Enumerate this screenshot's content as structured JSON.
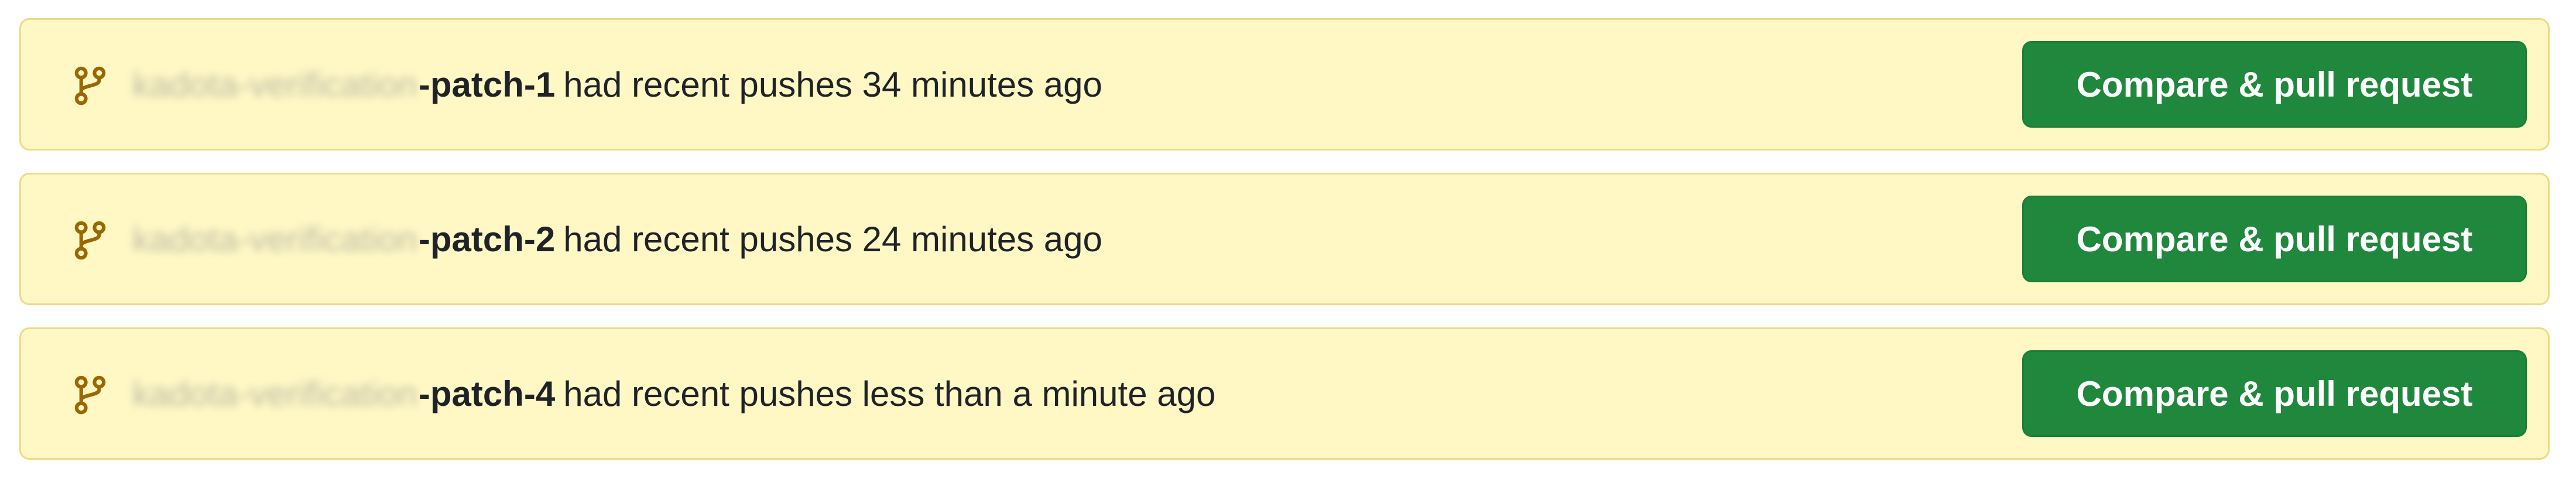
{
  "colors": {
    "banner_background": "#fff8c5",
    "banner_border": "#eedb82",
    "icon": "#9a6700",
    "button_background": "#1f883d",
    "button_text": "#ffffff",
    "text": "#1f2328"
  },
  "banners": [
    {
      "icon": "git-branch-icon",
      "branch_owner": "kadota-verification",
      "branch_suffix": "-patch-1",
      "message": "had recent pushes 34 minutes ago",
      "button_label": "Compare & pull request"
    },
    {
      "icon": "git-branch-icon",
      "branch_owner": "kadota-verification",
      "branch_suffix": "-patch-2",
      "message": "had recent pushes 24 minutes ago",
      "button_label": "Compare & pull request"
    },
    {
      "icon": "git-branch-icon",
      "branch_owner": "kadota-verification",
      "branch_suffix": "-patch-4",
      "message": "had recent pushes less than a minute ago",
      "button_label": "Compare & pull request"
    }
  ]
}
